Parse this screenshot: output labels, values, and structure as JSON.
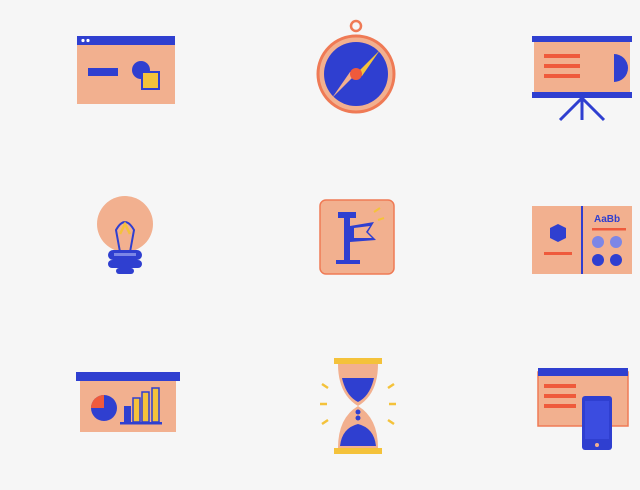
{
  "palette": {
    "background": "#f6f6f6",
    "peach": "#f2b08f",
    "blue": "#2f3fd0",
    "orange": "#ef5a3c",
    "yellow": "#f4c23a",
    "outline": "#ef7a55"
  },
  "icons": [
    {
      "name": "web-layout-icon"
    },
    {
      "name": "compass-icon"
    },
    {
      "name": "presentation-board-icon"
    },
    {
      "name": "lightbulb-icon"
    },
    {
      "name": "flag-icon"
    },
    {
      "name": "style-guide-icon"
    },
    {
      "name": "chart-dashboard-icon"
    },
    {
      "name": "hourglass-icon"
    },
    {
      "name": "responsive-devices-icon"
    }
  ],
  "style_guide": {
    "font_sample": "AaBb"
  }
}
